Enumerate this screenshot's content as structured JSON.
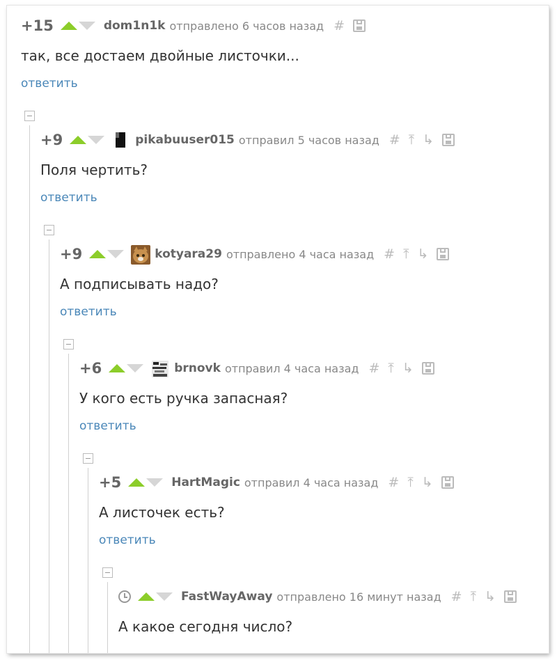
{
  "comments": [
    {
      "rating": "+15",
      "user": "dom1n1k",
      "meta": "отправлено 6 часов назад",
      "text": "так, все достаем двойные листочки...",
      "reply": "ответить"
    },
    {
      "rating": "+9",
      "user": "pikabuuser015",
      "meta": "отправил 5 часов назад",
      "text": "Поля чертить?",
      "reply": "ответить"
    },
    {
      "rating": "+9",
      "user": "kotyara29",
      "meta": "отправлено 4 часа назад",
      "text": "А подписывать надо?",
      "reply": "ответить"
    },
    {
      "rating": "+6",
      "user": "brnovk",
      "meta": "отправил 4 часа назад",
      "text": "У кого есть ручка запасная?",
      "reply": "ответить"
    },
    {
      "rating": "+5",
      "user": "HartMagic",
      "meta": "отправил 4 часа назад",
      "text": "А листочек есть?",
      "reply": "ответить"
    },
    {
      "rating": "",
      "user": "FastWayAway",
      "meta": "отправлено 16 минут назад",
      "text": "А какое сегодня число?",
      "reply": ""
    }
  ],
  "icons": {
    "hash": "#",
    "parent": "⤒",
    "thread": "↳"
  },
  "colors": {
    "vote_up": "#8ccd2a",
    "vote_down": "#d6d6d6",
    "reply_link": "#4a87b8"
  }
}
